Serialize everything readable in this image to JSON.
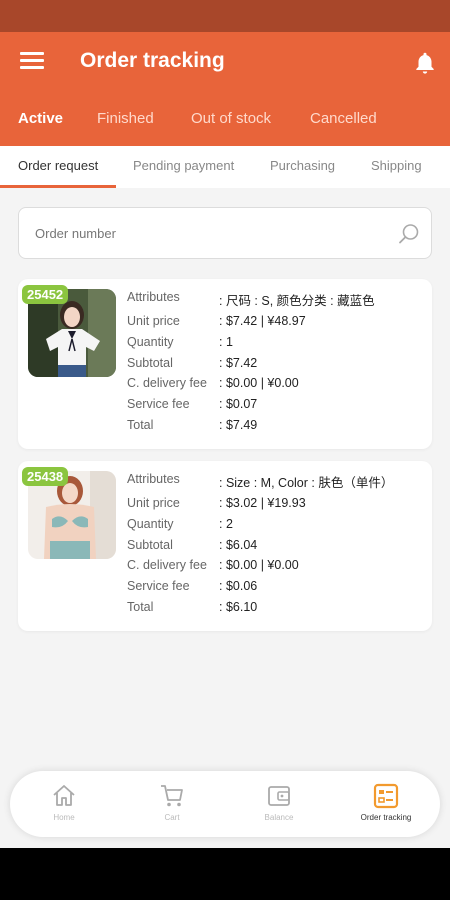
{
  "header": {
    "title": "Order tracking",
    "status_tabs": [
      "Active",
      "Finished",
      "Out of stock",
      "Cancelled"
    ]
  },
  "sub_tabs": [
    "Order request",
    "Pending payment",
    "Purchasing",
    "Shipping"
  ],
  "search": {
    "placeholder": "Order number"
  },
  "labels": {
    "attributes": "Attributes",
    "unit_price": "Unit price",
    "quantity": "Quantity",
    "subtotal": "Subtotal",
    "delivery_fee": "C. delivery fee",
    "service_fee": "Service fee",
    "total": "Total"
  },
  "orders": [
    {
      "id": "25452",
      "attributes": ": 尺码 : S, 颜色分类 : 藏蓝色",
      "unit_price": ": $7.42 | ¥48.97",
      "quantity": ": 1",
      "subtotal": ": $7.42",
      "delivery_fee": ": $0.00 | ¥0.00",
      "service_fee": ": $0.07",
      "total": ": $7.49"
    },
    {
      "id": "25438",
      "attributes": ": Size : M, Color : 肤色（单件）",
      "unit_price": ": $3.02 | ¥19.93",
      "quantity": ": 2",
      "subtotal": ": $6.04",
      "delivery_fee": ": $0.00 | ¥0.00",
      "service_fee": ": $0.06",
      "total": ": $6.10"
    }
  ],
  "bottom_nav": [
    {
      "label": "Home",
      "icon": "home-icon"
    },
    {
      "label": "Cart",
      "icon": "cart-icon"
    },
    {
      "label": "Balance",
      "icon": "wallet-icon"
    },
    {
      "label": "Order tracking",
      "icon": "order-tracking-icon"
    }
  ],
  "colors": {
    "accent": "#e8643a",
    "status_bar": "#a8472a",
    "badge": "#8bc53f"
  }
}
